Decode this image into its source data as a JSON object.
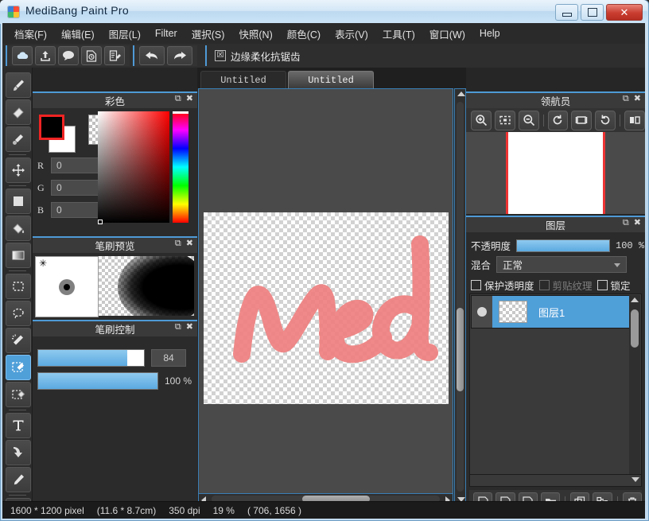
{
  "window": {
    "title": "MediBang Paint Pro",
    "icon": "medibang-logo-icon",
    "minimize_label": "–",
    "restore_label": "□",
    "close_label": "✕"
  },
  "menu": {
    "items": [
      {
        "label": "档案(F)",
        "name": "menu-file"
      },
      {
        "label": "编辑(E)",
        "name": "menu-edit"
      },
      {
        "label": "图层(L)",
        "name": "menu-layer"
      },
      {
        "label": "Filter",
        "name": "menu-filter"
      },
      {
        "label": "選択(S)",
        "name": "menu-select"
      },
      {
        "label": "快照(N)",
        "name": "menu-snapshot"
      },
      {
        "label": "颜色(C)",
        "name": "menu-color"
      },
      {
        "label": "表示(V)",
        "name": "menu-view"
      },
      {
        "label": "工具(T)",
        "name": "menu-tool"
      },
      {
        "label": "窗口(W)",
        "name": "menu-window"
      },
      {
        "label": "Help",
        "name": "menu-help"
      }
    ]
  },
  "toolbar": {
    "buttons": [
      {
        "icon": "cloud-icon",
        "name": "cloud-button"
      },
      {
        "icon": "upload-icon",
        "name": "upload-button"
      },
      {
        "icon": "comment-icon",
        "name": "comment-button"
      },
      {
        "icon": "snapshot-icon",
        "name": "snapshot-button"
      },
      {
        "icon": "edit-page-icon",
        "name": "edit-page-button"
      }
    ],
    "undo": {
      "icon": "undo-arrow-icon",
      "name": "undo-button"
    },
    "redo": {
      "icon": "redo-arrow-icon",
      "name": "redo-button"
    },
    "antialias": {
      "label": "边缘柔化抗锯齿",
      "checked": true,
      "check_glyph": "☒"
    }
  },
  "tools": [
    {
      "name": "brush-tool",
      "icon": "brush-icon",
      "active": false
    },
    {
      "name": "eraser-tool",
      "icon": "eraser-icon",
      "active": false
    },
    {
      "name": "blur-tool",
      "icon": "blur-icon",
      "active": false
    },
    {
      "name": "move-tool",
      "icon": "move-arrows-icon",
      "active": false
    },
    {
      "name": "fill-rect-tool",
      "icon": "filled-square-icon",
      "active": false
    },
    {
      "name": "bucket-tool",
      "icon": "paint-bucket-icon",
      "active": false
    },
    {
      "name": "gradient-tool",
      "icon": "gradient-icon",
      "active": false
    },
    {
      "name": "rect-select-tool",
      "icon": "rect-marquee-icon",
      "active": false
    },
    {
      "name": "lasso-select-tool",
      "icon": "lasso-icon",
      "active": false
    },
    {
      "name": "magic-wand-tool",
      "icon": "magic-wand-icon",
      "active": false
    },
    {
      "name": "select-pen-tool",
      "icon": "select-pen-icon",
      "active": true
    },
    {
      "name": "select-eraser-tool",
      "icon": "select-eraser-icon",
      "active": false
    },
    {
      "name": "text-tool",
      "icon": "text-T-icon",
      "active": false
    },
    {
      "name": "operation-tool",
      "icon": "cursor-arrow-icon",
      "active": false
    },
    {
      "name": "dropper-tool",
      "icon": "eyedropper-icon",
      "active": false
    }
  ],
  "color_panel": {
    "title": "彩色",
    "foreground_hex": "#000000",
    "background_hex": "#ffffff",
    "transparent_swatch": "checker",
    "channels": [
      {
        "label": "R",
        "value": "0"
      },
      {
        "label": "G",
        "value": "0"
      },
      {
        "label": "B",
        "value": "0"
      }
    ],
    "hue_hex": "#ff0000",
    "float_icon": "undock-icon",
    "close_icon": "close-icon"
  },
  "brush_preview": {
    "title": "笔刷预览",
    "star_glyph": "✳",
    "float_icon": "undock-icon",
    "close_icon": "close-icon"
  },
  "brush_control": {
    "title": "笔刷控制",
    "size": {
      "value": "84",
      "fill_percent": 84
    },
    "opacity": {
      "value": "100",
      "unit": "%",
      "fill_percent": 100
    },
    "float_icon": "undock-icon",
    "close_icon": "close-icon"
  },
  "canvas": {
    "tabs": [
      {
        "label": "Untitled",
        "active": false
      },
      {
        "label": "Untitled",
        "active": true
      }
    ],
    "artwork_text": "med",
    "artwork_color": "#ef8080",
    "background": "transparent-checker"
  },
  "navigator": {
    "title": "领航员",
    "buttons": [
      {
        "icon": "zoom-in-icon",
        "name": "zoom-in-button"
      },
      {
        "icon": "fit-screen-icon",
        "name": "fit-screen-button"
      },
      {
        "icon": "zoom-out-icon",
        "name": "zoom-out-button"
      },
      {
        "icon": "rotate-left-icon",
        "name": "rotate-left-button"
      },
      {
        "icon": "reset-view-icon",
        "name": "reset-view-button"
      },
      {
        "icon": "rotate-right-icon",
        "name": "rotate-right-button"
      },
      {
        "icon": "flip-horizontal-icon",
        "name": "flip-horizontal-button"
      }
    ],
    "guide_color": "#ee3333",
    "float_icon": "undock-icon",
    "close_icon": "close-icon"
  },
  "layers": {
    "title": "图层",
    "opacity_label": "不透明度",
    "opacity_value": "100",
    "opacity_unit": "%",
    "blend_label": "混合",
    "blend_value": "正常",
    "locks": [
      {
        "label": "保护透明度",
        "checked": false,
        "dim": false
      },
      {
        "label": "剪贴纹理",
        "checked": false,
        "dim": true
      },
      {
        "label": "锁定",
        "checked": false,
        "dim": false
      }
    ],
    "items": [
      {
        "name": "图层1",
        "selected": true,
        "visible": true
      }
    ],
    "buttons": [
      {
        "icon": "new-layer-icon",
        "name": "new-layer-button"
      },
      {
        "icon": "new-8bit-layer-icon",
        "name": "new-8bit-layer-button"
      },
      {
        "icon": "new-1bit-layer-icon",
        "name": "new-1bit-layer-button"
      },
      {
        "icon": "new-folder-icon",
        "name": "new-folder-button"
      },
      {
        "icon": "duplicate-layer-icon",
        "name": "duplicate-layer-button"
      },
      {
        "icon": "merge-layer-icon",
        "name": "merge-layer-button"
      },
      {
        "icon": "delete-layer-icon",
        "name": "delete-layer-button"
      }
    ],
    "float_icon": "undock-icon",
    "close_icon": "close-icon"
  },
  "status_bar": {
    "dimensions": "1600 * 1200 pixel",
    "physical": "(11.6 * 8.7cm)",
    "dpi": "350 dpi",
    "zoom": "19 %",
    "cursor": "( 706, 1656 )"
  },
  "accent": {
    "panel_accent": "#4e9ad6",
    "selection_blue": "#4f9fd9",
    "app_bg": "#2b2b2b"
  }
}
